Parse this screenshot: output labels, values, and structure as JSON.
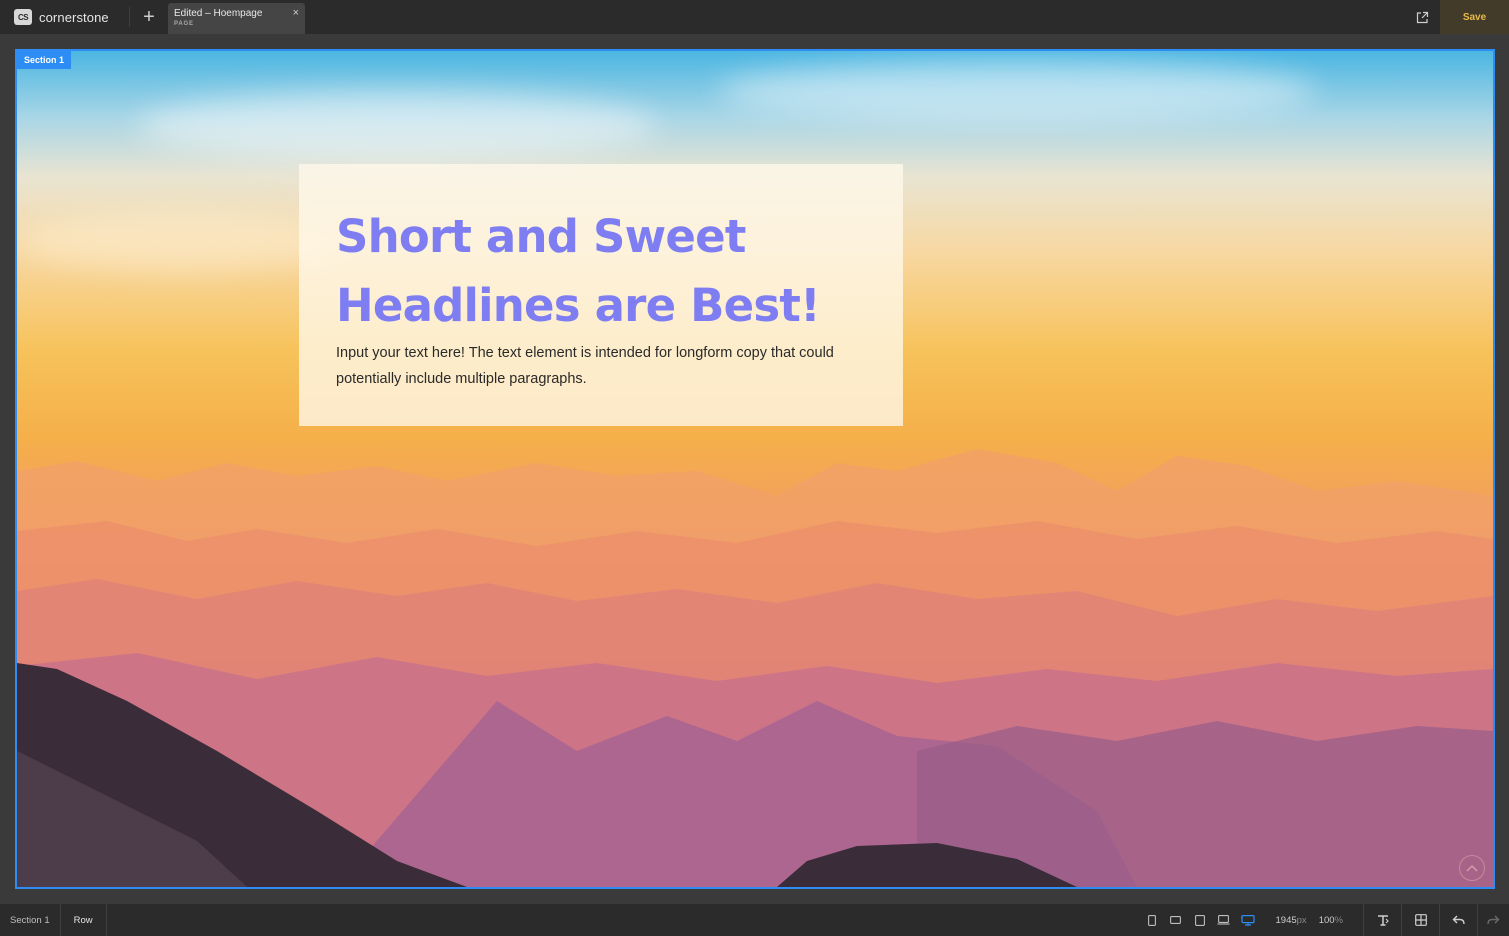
{
  "topbar": {
    "brand_mark": "CS",
    "brand_name": "cornerstone",
    "add_label": "+",
    "tab": {
      "title": "Edited – Hoempage",
      "type": "PAGE",
      "close": "×"
    },
    "save_label": "Save"
  },
  "canvas": {
    "section_label": "Section 1",
    "headline_line1": "Short and Sweet",
    "headline_line2": "Headlines are Best!",
    "body_line1": "Input your text here! The text element is intended for longform copy that could",
    "body_line2": "potentially include multiple paragraphs."
  },
  "bottombar": {
    "breadcrumbs": [
      "Section 1",
      "Row"
    ],
    "width_value": "1945",
    "width_unit": "px",
    "zoom_value": "100",
    "zoom_unit": "%"
  },
  "colors": {
    "accent": "#2d8df5",
    "headline": "#7e7ef2",
    "save": "#e9bb4a"
  }
}
